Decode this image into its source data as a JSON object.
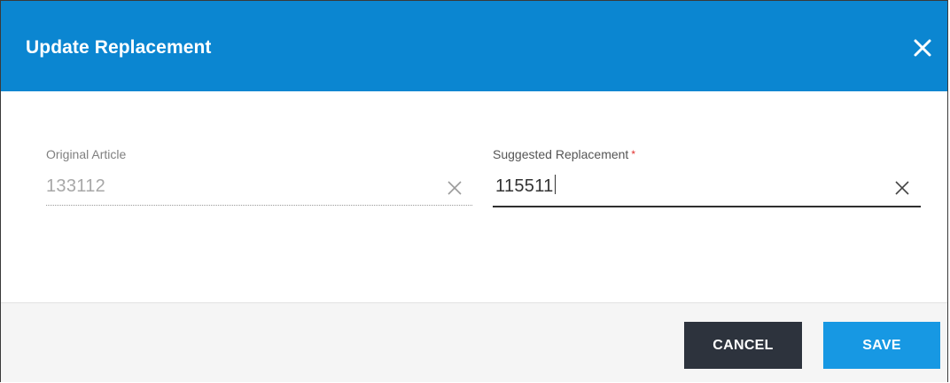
{
  "dialog": {
    "title": "Update Replacement",
    "close_icon": "close-icon"
  },
  "fields": {
    "original": {
      "label": "Original Article",
      "value": "133112",
      "clear_icon": "clear-icon",
      "disabled": true
    },
    "replacement": {
      "label": "Suggested Replacement",
      "required_marker": "*",
      "value": "115511",
      "clear_icon": "clear-icon",
      "focused": true
    }
  },
  "footer": {
    "cancel_label": "CANCEL",
    "save_label": "SAVE"
  },
  "colors": {
    "header": "#0b86d1",
    "cancel": "#2d333d",
    "save": "#1798e3",
    "required": "#e0312d"
  }
}
